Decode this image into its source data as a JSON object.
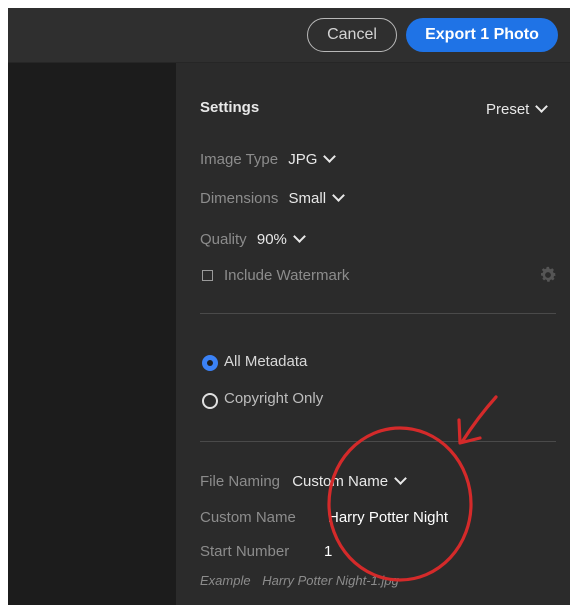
{
  "toolbar": {
    "cancel_label": "Cancel",
    "export_label": "Export 1 Photo"
  },
  "settings": {
    "heading": "Settings",
    "preset_label": "Preset",
    "image_type": {
      "label": "Image Type",
      "value": "JPG"
    },
    "dimensions": {
      "label": "Dimensions",
      "value": "Small"
    },
    "quality": {
      "label": "Quality",
      "value": "90%"
    },
    "watermark": {
      "label": "Include Watermark",
      "checked": false
    }
  },
  "metadata": {
    "options": [
      {
        "label": "All Metadata",
        "selected": true
      },
      {
        "label": "Copyright Only",
        "selected": false
      }
    ]
  },
  "naming": {
    "file_naming": {
      "label": "File Naming",
      "value": "Custom Name"
    },
    "custom_name": {
      "label": "Custom Name",
      "value": "Harry Potter Night"
    },
    "start_number": {
      "label": "Start Number",
      "value": "1"
    },
    "example": {
      "label": "Example",
      "value": "Harry Potter Night-1.jpg"
    }
  },
  "colors": {
    "accent": "#1f73e6",
    "radio": "#3b82f6",
    "annotation": "#d42a2a"
  },
  "icons": {
    "gear": "gear-icon",
    "chevron": "chevron-down-icon"
  }
}
